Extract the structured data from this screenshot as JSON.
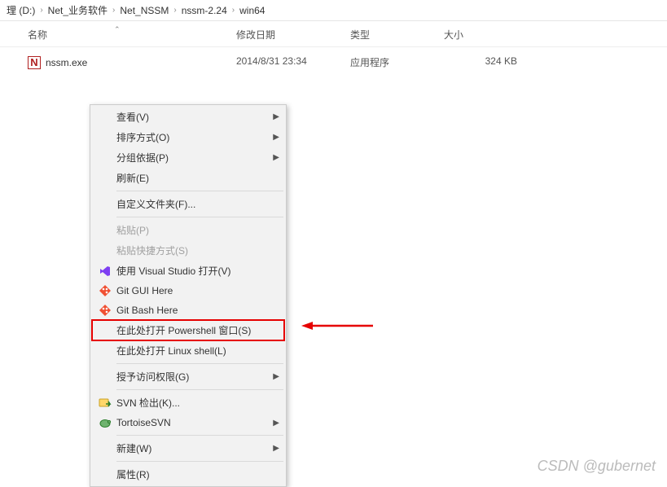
{
  "breadcrumb": {
    "items": [
      "理 (D:)",
      "Net_业务软件",
      "Net_NSSM",
      "nssm-2.24",
      "win64"
    ]
  },
  "columns": {
    "name": "名称",
    "date": "修改日期",
    "type": "类型",
    "size": "大小"
  },
  "files": [
    {
      "name": "nssm.exe",
      "icon": "N",
      "date": "2014/8/31 23:34",
      "type": "应用程序",
      "size": "324 KB"
    }
  ],
  "menu": {
    "items": [
      {
        "label": "查看(V)",
        "submenu": true
      },
      {
        "label": "排序方式(O)",
        "submenu": true
      },
      {
        "label": "分组依据(P)",
        "submenu": true
      },
      {
        "label": "刷新(E)"
      },
      {
        "sep": true
      },
      {
        "label": "自定义文件夹(F)..."
      },
      {
        "sep": true
      },
      {
        "label": "粘贴(P)",
        "disabled": true
      },
      {
        "label": "粘贴快捷方式(S)",
        "disabled": true
      },
      {
        "label": "使用 Visual Studio 打开(V)",
        "icon": "vs"
      },
      {
        "label": "Git GUI Here",
        "icon": "git"
      },
      {
        "label": "Git Bash Here",
        "icon": "git"
      },
      {
        "label": "在此处打开 Powershell 窗口(S)",
        "highlighted": true
      },
      {
        "label": "在此处打开 Linux shell(L)"
      },
      {
        "sep": true
      },
      {
        "label": "授予访问权限(G)",
        "submenu": true
      },
      {
        "sep": true
      },
      {
        "label": "SVN 检出(K)...",
        "icon": "svn-checkout"
      },
      {
        "label": "TortoiseSVN",
        "icon": "tortoise",
        "submenu": true
      },
      {
        "sep": true
      },
      {
        "label": "新建(W)",
        "submenu": true
      },
      {
        "sep": true
      },
      {
        "label": "属性(R)"
      }
    ]
  },
  "watermark": "CSDN @gubernet"
}
